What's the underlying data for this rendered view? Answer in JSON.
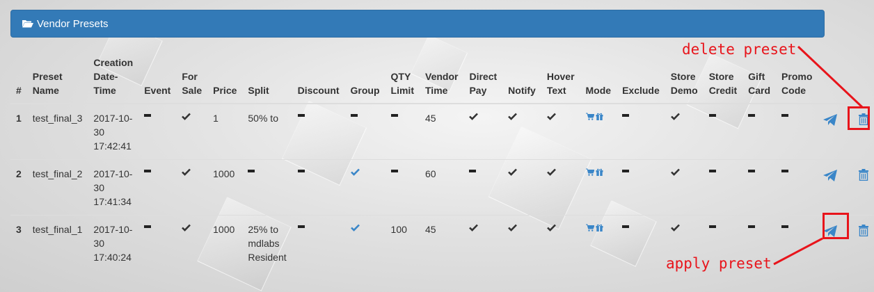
{
  "panel": {
    "title": "Vendor Presets",
    "icon": "folder-open-icon"
  },
  "table": {
    "headers": [
      "#",
      "Preset Name",
      "Creation Date-Time",
      "Event",
      "For Sale",
      "Price",
      "Split",
      "Discount",
      "Group",
      "QTY Limit",
      "Vendor Time",
      "Direct Pay",
      "Notify",
      "Hover Text",
      "Mode",
      "Exclude",
      "Store Demo",
      "Store Credit",
      "Gift Card",
      "Promo Code"
    ],
    "header_lines": [
      [
        "#"
      ],
      [
        "Preset",
        "Name"
      ],
      [
        "Creation",
        "Date-",
        "Time"
      ],
      [
        "Event"
      ],
      [
        "For",
        "Sale"
      ],
      [
        "Price"
      ],
      [
        "Split"
      ],
      [
        "Discount"
      ],
      [
        "Group"
      ],
      [
        "QTY",
        "Limit"
      ],
      [
        "Vendor",
        "Time"
      ],
      [
        "Direct",
        "Pay"
      ],
      [
        "Notify"
      ],
      [
        "Hover",
        "Text"
      ],
      [
        "Mode"
      ],
      [
        "Exclude"
      ],
      [
        "Store",
        "Demo"
      ],
      [
        "Store",
        "Credit"
      ],
      [
        "Gift",
        "Card"
      ],
      [
        "Promo",
        "Code"
      ]
    ],
    "rows": [
      {
        "num": "1",
        "name": "test_final_3",
        "date": "2017-10-",
        "date2": "30",
        "time": "17:42:41",
        "event": "dash",
        "for_sale": "check",
        "price": "1",
        "split": [
          "50% to"
        ],
        "discount": "dash",
        "group": "dash",
        "qty_limit": "dash",
        "vendor_time": "45",
        "direct_pay": "check",
        "notify": "check",
        "hover_text": "check",
        "mode": "icons",
        "exclude": "dash",
        "store_demo": "check",
        "store_credit": "dash",
        "gift_card": "dash",
        "promo_code": "dash"
      },
      {
        "num": "2",
        "name": "test_final_2",
        "date": "2017-10-",
        "date2": "30",
        "time": "17:41:34",
        "event": "dash",
        "for_sale": "check",
        "price": "1000",
        "split": "dash",
        "discount": "dash",
        "group": "check-blue",
        "qty_limit": "dash",
        "vendor_time": "60",
        "direct_pay": "dash",
        "notify": "check",
        "hover_text": "check",
        "mode": "icons",
        "exclude": "dash",
        "store_demo": "check",
        "store_credit": "dash",
        "gift_card": "dash",
        "promo_code": "dash"
      },
      {
        "num": "3",
        "name": "test_final_1",
        "date": "2017-10-",
        "date2": "30",
        "time": "17:40:24",
        "event": "dash",
        "for_sale": "check",
        "price": "1000",
        "split": [
          "25% to",
          "mdlabs",
          "Resident"
        ],
        "discount": "dash",
        "group": "check-blue",
        "qty_limit": "100",
        "vendor_time": "45",
        "direct_pay": "check",
        "notify": "check",
        "hover_text": "check",
        "mode": "icons",
        "exclude": "dash",
        "store_demo": "check",
        "store_credit": "dash",
        "gift_card": "dash",
        "promo_code": "dash"
      }
    ]
  },
  "annotations": {
    "delete": "delete preset",
    "apply": "apply preset"
  },
  "colors": {
    "header_bg": "#337ab7",
    "accent_blue": "#337ab7",
    "annotation_red": "#e8141b"
  }
}
